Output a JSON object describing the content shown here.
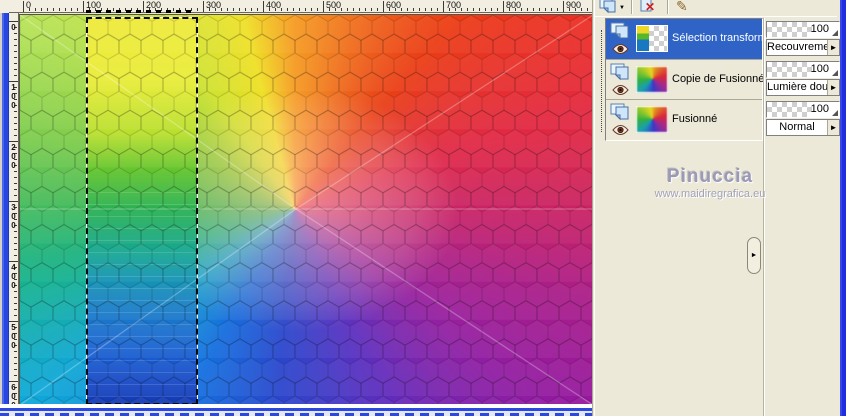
{
  "rulers": {
    "horizontal": [
      "0",
      "100",
      "200",
      "300",
      "400",
      "500",
      "600",
      "700",
      "800",
      "900"
    ],
    "vertical": [
      "0",
      "100",
      "200",
      "300",
      "400",
      "500",
      "600"
    ]
  },
  "palette": {
    "toolbar_icons": [
      {
        "name": "new-layer-icon"
      },
      {
        "name": "delete-layer-icon"
      },
      {
        "name": "edit-selection-icon"
      }
    ],
    "layers": [
      {
        "name": "Sélection transformé",
        "selected": true,
        "opacity": "100",
        "blend_mode": "Recouvrement"
      },
      {
        "name": "Copie de Fusionné",
        "selected": false,
        "opacity": "100",
        "blend_mode": "Lumière douce"
      },
      {
        "name": "Fusionné",
        "selected": false,
        "opacity": "100",
        "blend_mode": "Normal"
      }
    ]
  },
  "watermark": {
    "title": "Pinuccia",
    "site": "www.maidiregrafica.eu"
  },
  "icons": {
    "dropdown_arrow": "►",
    "toolbar_dropdown": "▼",
    "delete_x": "✕",
    "edit_pencil": "✎",
    "handle_arrow": "►"
  },
  "colors": {
    "selected_row": "#2f63c5",
    "palette_bg": "#ece9d8",
    "window_border_blue": "#1f2fe0",
    "ruler_bg": "#f2efe2"
  }
}
